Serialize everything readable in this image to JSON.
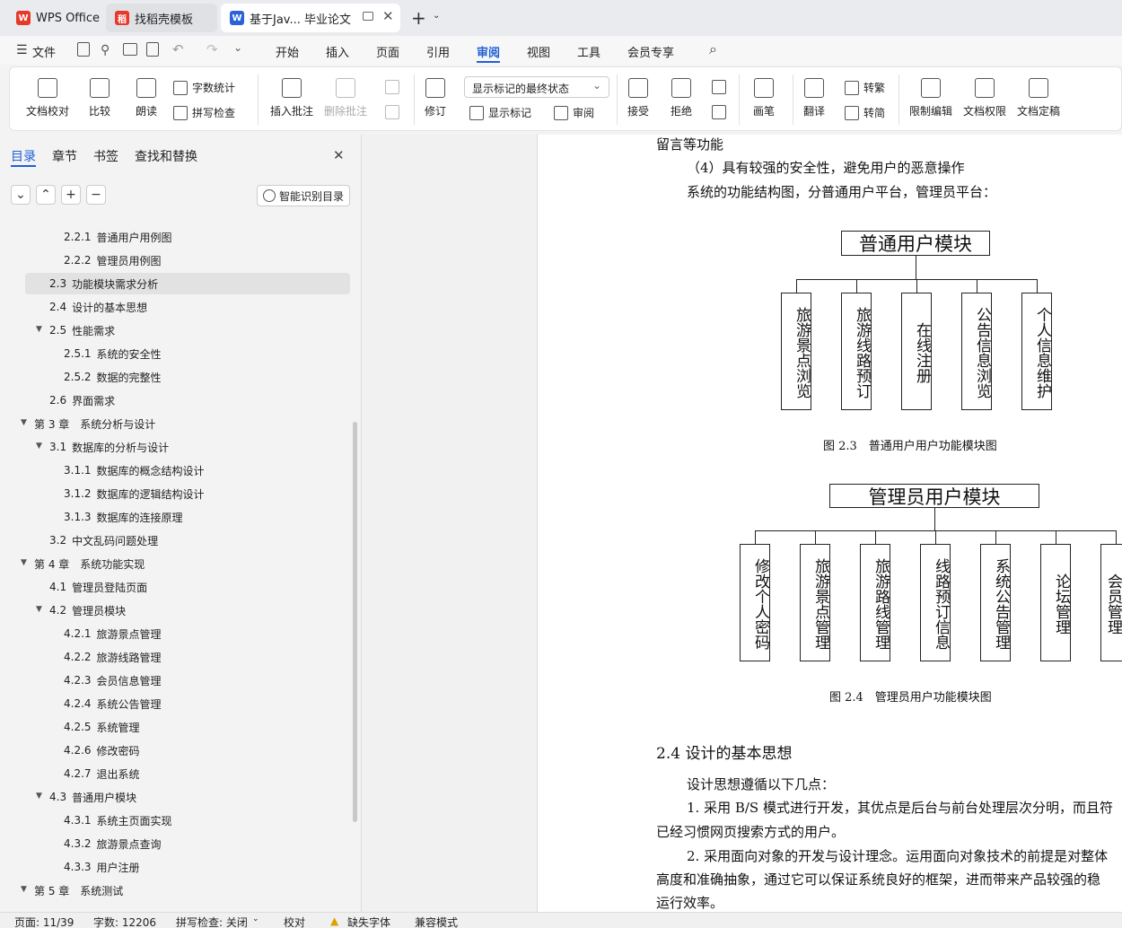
{
  "tabs": [
    {
      "label": "WPS Office",
      "icon": "wps-logo-icon",
      "badge": "W"
    },
    {
      "label": "找稻壳模板",
      "icon": "docer-icon",
      "badge": "稻"
    },
    {
      "label": "基于Jav... 毕业论文",
      "icon": "writer-doc-icon",
      "badge": "W"
    }
  ],
  "new_tab_symbol": "+",
  "menu": {
    "file": "文件",
    "items": [
      "开始",
      "插入",
      "页面",
      "引用",
      "审阅",
      "视图",
      "工具",
      "会员专享"
    ],
    "active": "审阅"
  },
  "ribbon": {
    "doc_check": "文档校对",
    "compare": "比较",
    "read_aloud": "朗读",
    "word_count": "字数统计",
    "spell_check": "拼写检查",
    "insert_comment": "插入批注",
    "delete_comment": "删除批注",
    "revise": "修订",
    "markup_state": "显示标记的最终状态",
    "show_markup": "显示标记",
    "review": "审阅",
    "accept": "接受",
    "reject": "拒绝",
    "pen": "画笔",
    "translate": "翻译",
    "to_traditional": "转繁",
    "to_simplified": "转简",
    "restrict_edit": "限制编辑",
    "doc_permission": "文档权限",
    "doc_finalize": "文档定稿"
  },
  "nav_panel": {
    "tabs": [
      "目录",
      "章节",
      "书签",
      "查找和替换"
    ],
    "active_tab": "目录",
    "smart_toc": "智能识别目录",
    "items": [
      {
        "num": "2.2.1",
        "text": "普通用户用例图",
        "level": 3
      },
      {
        "num": "2.2.2",
        "text": "管理员用例图",
        "level": 3
      },
      {
        "num": "2.3",
        "text": "功能模块需求分析",
        "level": 2,
        "selected": true
      },
      {
        "num": "2.4",
        "text": "设计的基本思想",
        "level": 2
      },
      {
        "num": "2.5",
        "text": "性能需求",
        "level": 2,
        "expanded": true
      },
      {
        "num": "2.5.1",
        "text": "系统的安全性",
        "level": 3
      },
      {
        "num": "2.5.2",
        "text": "数据的完整性",
        "level": 3
      },
      {
        "num": "2.6",
        "text": "界面需求",
        "level": 2
      },
      {
        "num": "第 3 章",
        "text": "系统分析与设计",
        "level": 1,
        "expanded": true
      },
      {
        "num": "3.1",
        "text": "数据库的分析与设计",
        "level": 2,
        "expanded": true
      },
      {
        "num": "3.1.1",
        "text": "数据库的概念结构设计",
        "level": 3
      },
      {
        "num": "3.1.2",
        "text": "数据库的逻辑结构设计",
        "level": 3
      },
      {
        "num": "3.1.3",
        "text": "数据库的连接原理",
        "level": 3
      },
      {
        "num": "3.2",
        "text": "中文乱码问题处理",
        "level": 2
      },
      {
        "num": "第 4 章",
        "text": "系统功能实现",
        "level": 1,
        "expanded": true
      },
      {
        "num": "4.1",
        "text": "管理员登陆页面",
        "level": 2
      },
      {
        "num": "4.2",
        "text": "管理员模块",
        "level": 2,
        "expanded": true
      },
      {
        "num": "4.2.1",
        "text": "旅游景点管理",
        "level": 3
      },
      {
        "num": "4.2.2",
        "text": "旅游线路管理",
        "level": 3
      },
      {
        "num": "4.2.3",
        "text": "会员信息管理",
        "level": 3
      },
      {
        "num": "4.2.4",
        "text": "系统公告管理",
        "level": 3
      },
      {
        "num": "4.2.5",
        "text": "系统管理",
        "level": 3
      },
      {
        "num": "4.2.6",
        "text": "修改密码",
        "level": 3
      },
      {
        "num": "4.2.7",
        "text": "退出系统",
        "level": 3
      },
      {
        "num": "4.3",
        "text": "普通用户模块",
        "level": 2,
        "expanded": true
      },
      {
        "num": "4.3.1",
        "text": "系统主页面实现",
        "level": 3
      },
      {
        "num": "4.3.2",
        "text": "旅游景点查询",
        "level": 3
      },
      {
        "num": "4.3.3",
        "text": "用户注册",
        "level": 3
      },
      {
        "num": "第 5 章",
        "text": "系统测试",
        "level": 1,
        "expanded": true
      }
    ]
  },
  "document": {
    "line1": "留言等功能",
    "line2": "（4）具有较强的安全性，避免用户的恶意操作",
    "line3": "系统的功能结构图，分普通用户平台，管理员平台：",
    "diagram1": {
      "root": "普通用户模块",
      "children": [
        "旅游景点浏览",
        "旅游线路预订",
        "在线注册",
        "公告信息浏览",
        "个人信息维护"
      ],
      "caption": "图 2.3　普通用户用户功能模块图"
    },
    "diagram2": {
      "root": "管理员用户模块",
      "children": [
        "修改个人密码",
        "旅游景点管理",
        "旅游路线管理",
        "线路预订信息",
        "系统公告管理",
        "论坛管理",
        "会员管理"
      ],
      "caption": "图 2.4　管理员用户功能模块图"
    },
    "heading": "2.4  设计的基本思想",
    "p1": "设计思想遵循以下几点：",
    "p2a": "1. 采用 B/S 模式进行开发，其优点是后台与前台处理层次分明，而且符",
    "p2b": "已经习惯网页搜索方式的用户。",
    "p3a": "2. 采用面向对象的开发与设计理念。运用面向对象技术的前提是对整体",
    "p3b": "高度和准确抽象，通过它可以保证系统良好的框架，进而带来产品较强的稳",
    "p3c": "运行效率。"
  },
  "status": {
    "page": "页面: 11/39",
    "words": "字数: 12206",
    "spell": "拼写检查: 关闭",
    "proof": "校对",
    "missing_font": "缺失字体",
    "compat": "兼容模式"
  }
}
